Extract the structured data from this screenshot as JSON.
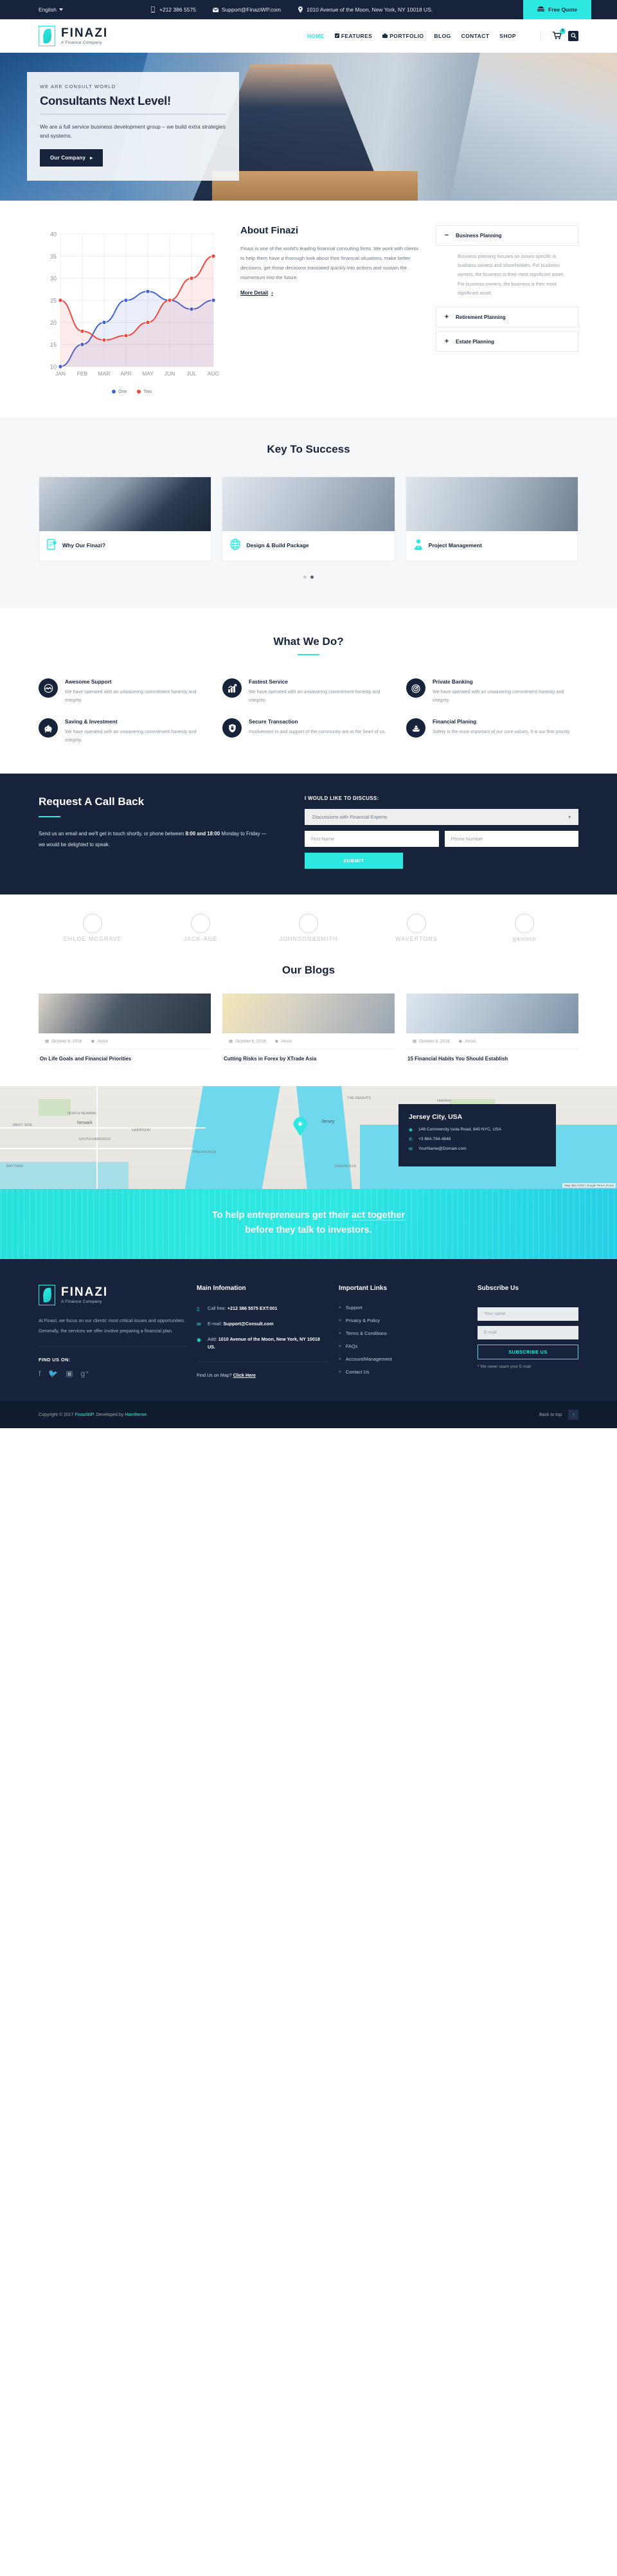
{
  "topbar": {
    "language": "English",
    "phone": "+212 386 5575",
    "email": "Support@FinaziWP.com",
    "address": "1010 Avenue of the Moon, New York, NY 10018 US.",
    "free_quote": "Free Quote",
    "accent": "#2ce8e0",
    "bg": "#16233a"
  },
  "nav": {
    "brand": "FINAZI",
    "tagline": "A Finance Company",
    "items": [
      {
        "label": "HOME",
        "active": true,
        "icon": ""
      },
      {
        "label": "FEATURES",
        "active": false,
        "icon": "check-square-icon"
      },
      {
        "label": "PORTFOLIO",
        "active": false,
        "icon": "briefcase-icon"
      },
      {
        "label": "BLOG",
        "active": false,
        "icon": ""
      },
      {
        "label": "CONTACT",
        "active": false,
        "icon": ""
      },
      {
        "label": "SHOP",
        "active": false,
        "icon": ""
      }
    ],
    "cart_count": "0"
  },
  "hero": {
    "eyebrow": "WE ARE CONSULT WORLD",
    "title": "Consultants Next Level!",
    "subtitle": "We are a full service business development group – we build extra strategies and systems.",
    "button": "Our Company"
  },
  "about": {
    "title": "About Finazi",
    "body": "Finazi is one of the world's leading financial consulting firms. We work with clients to help them have a thorough look about their financial situations, make better decisions, get those decisions translated quickly into actions and sustain the momentum into the future.",
    "more_link": "More Detail",
    "accordion": [
      {
        "sign": "−",
        "title": "Business Planning",
        "body": "Business planning focuses on issues specific to business owners and shareholders. For business owners, the business is their most significant asset.\nFor business owners, the business is their most significant asset.",
        "open": true
      },
      {
        "sign": "+",
        "title": "Retirement Planning",
        "body": "",
        "open": false
      },
      {
        "sign": "+",
        "title": "Estate Planning",
        "body": "",
        "open": false
      }
    ]
  },
  "chart_data": {
    "type": "line",
    "title": "",
    "xlabel": "",
    "ylabel": "",
    "categories": [
      "JAN",
      "FEB",
      "MAR",
      "APR",
      "MAY",
      "JUN",
      "JUL",
      "AUG"
    ],
    "ylim": [
      10,
      40
    ],
    "yticks": [
      10,
      15,
      20,
      25,
      30,
      35,
      40
    ],
    "grid": true,
    "legend_position": "bottom",
    "series": [
      {
        "name": "One",
        "color": "#3c63d8",
        "values": [
          10,
          15,
          20,
          25,
          27,
          25,
          23,
          25
        ]
      },
      {
        "name": "Two",
        "color": "#f0483c",
        "values": [
          25,
          18,
          16,
          17,
          20,
          25,
          30,
          35
        ]
      }
    ]
  },
  "key_to_success": {
    "title": "Key To Success",
    "cards": [
      {
        "label": "Why Our Finazi?",
        "icon": "document-pen-icon"
      },
      {
        "label": "Design & Build Package",
        "icon": "globe-icon"
      },
      {
        "label": "Project Management",
        "icon": "person-tie-icon"
      }
    ],
    "dots": [
      "off",
      "on"
    ]
  },
  "what_we_do": {
    "title": "What We Do?",
    "items": [
      {
        "icon": "handshake-globe-icon",
        "title": "Awesome Support",
        "text": "We have operated with an unwavering commitment honesty and integrity."
      },
      {
        "icon": "growth-chart-icon",
        "title": "Fastest Service",
        "text": "We have operated with an unwavering commitment honesty and integrity."
      },
      {
        "icon": "target-icon",
        "title": "Private Banking",
        "text": "We have operated with an unwavering commitment honesty and integrity."
      },
      {
        "icon": "piggy-bank-icon",
        "title": "Saving & Investment",
        "text": "We have operated with an unwavering commitment honesty and integrity."
      },
      {
        "icon": "lock-shield-icon",
        "title": "Secure Transaction",
        "text": "Involvement in and support of the community are at the heart of us."
      },
      {
        "icon": "money-boat-icon",
        "title": "Financial Planing",
        "text": "Safety is the most important of our core values. It is our first priority."
      }
    ]
  },
  "callback": {
    "title": "Request A Call Back",
    "text_a": "Send us an email and we'll get in touch shortly, or phone between ",
    "text_b": "8:00 and 18:00",
    "text_c": " Monday to Friday — we would be delighted to speak.",
    "form_label": "I WOULD LIKE TO DISCUSS:",
    "select_value": "Discussions with Financial Experts",
    "first_name_placeholder": "First Name",
    "phone_placeholder": "Phone Number",
    "submit_label": "SUBMIT"
  },
  "clients": [
    {
      "name": "CHLOE MCGRAVE",
      "sub": ""
    },
    {
      "name": "JACK-AGE",
      "sub": ""
    },
    {
      "name": "JOHNSON&SMITH",
      "sub": ""
    },
    {
      "name": "WAVERTONS",
      "sub": ""
    },
    {
      "name": "gamero",
      "sub": ""
    }
  ],
  "blogs": {
    "title": "Our Blogs",
    "posts": [
      {
        "date": "October 6, 2016",
        "author": "Ansol",
        "title": "On Life Goals and Financial Priorities"
      },
      {
        "date": "October 6, 2016",
        "author": "Ansol",
        "title": "Cutting Risks in Forex by XTrade Asia"
      },
      {
        "date": "October 6, 2016",
        "author": "Ansol",
        "title": "15 Financial Habits You Should Establish"
      }
    ]
  },
  "map": {
    "card_title": "Jersey City, USA",
    "address": "148 Commercity Isola Road, 840 NYC, USA",
    "phone": "+3 864-784-4848",
    "email": "YourName@Domain.com",
    "pin_label": "Jersey",
    "labels": [
      "WEST SIDE",
      "Newark",
      "NORTH NEWARK",
      "SOUTH HARRISON",
      "HARRISON",
      "THE HEIGHTS",
      "Hoboken",
      "GREENVILLE",
      "WEEHAWKEN",
      "BAYONNE"
    ],
    "credit": "Map data ©2017 Google  Terms of Use"
  },
  "cta": {
    "line1_a": "To help entrepreneurs get their ",
    "line1_b": "act together",
    "line2": "before they talk to investors."
  },
  "footer": {
    "brand": "FINAZI",
    "tagline": "A Finance Company",
    "description": "At Finazi, we focus on our clients' most critical issues and opportunities. Generally, the services we offer involve preparing a financial plan.",
    "find_us_on": "FIND US ON:",
    "socials": [
      "facebook-icon",
      "twitter-icon",
      "instagram-icon",
      "google-plus-icon"
    ],
    "main_info": {
      "heading": "Main Infomation",
      "call_label": "Call free:",
      "call_value": "+212 386 5575 EXT:001",
      "email_label": "E-mail:",
      "email_value": "Support@Consult.com",
      "add_label": "Add:",
      "add_value": "1010 Avenue of the Moon, New York, NY 10018 US.",
      "map_text": "Find Us on Map?",
      "map_link": "Click Here"
    },
    "important_links": {
      "heading": "Important Links",
      "items": [
        "Support",
        "Privacy & Policy",
        "Terms & Conditions",
        "FAQs",
        "Account/Management",
        "Contact Us"
      ]
    },
    "subscribe": {
      "heading": "Subscribe Us",
      "name_placeholder": "Your name",
      "email_placeholder": "E-mail",
      "button": "SUBSCRIBE US",
      "note": "* We never spam your E-mail"
    }
  },
  "copyright": {
    "prefix": "Copyright © 2017 ",
    "brand": "FinaziWP",
    "mid": ". Developed by ",
    "dev": "Haintheme",
    "suffix": ".",
    "back_to_top": "Back to top"
  }
}
